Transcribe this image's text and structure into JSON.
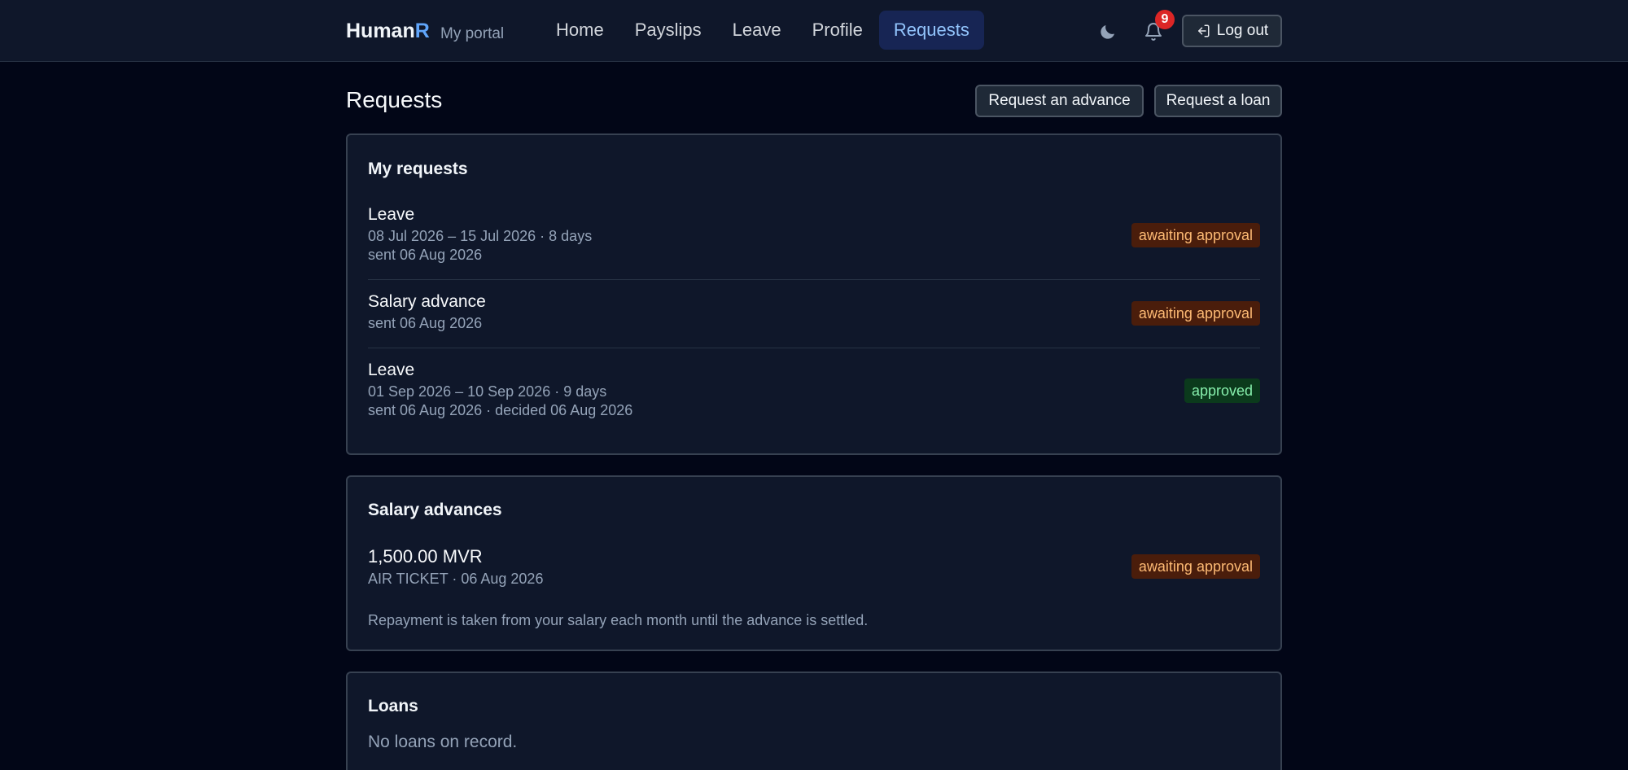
{
  "brand": {
    "name": "Human",
    "accent": "R",
    "subtitle": "My portal"
  },
  "nav": {
    "items": [
      {
        "label": "Home"
      },
      {
        "label": "Payslips"
      },
      {
        "label": "Leave"
      },
      {
        "label": "Profile"
      },
      {
        "label": "Requests",
        "active": true
      }
    ]
  },
  "header": {
    "notification_count": "9",
    "logout_label": "Log out",
    "theme_icon": "moon-icon",
    "bell_icon": "bell-icon",
    "logout_icon": "logout-icon"
  },
  "page": {
    "title": "Requests",
    "actions": {
      "advance_label": "Request an advance",
      "loan_label": "Request a loan"
    }
  },
  "my_requests": {
    "title": "My requests",
    "items": [
      {
        "type": "Leave",
        "line1": "08 Jul 2026 – 15 Jul 2026 · 8 days",
        "line2": "sent 06 Aug 2026",
        "status": "awaiting approval"
      },
      {
        "type": "Salary advance",
        "line1": "sent 06 Aug 2026",
        "status": "awaiting approval"
      },
      {
        "type": "Leave",
        "line1": "01 Sep 2026 – 10 Sep 2026 · 9 days",
        "line2": "sent 06 Aug 2026 · decided 06 Aug 2026",
        "status": "approved"
      }
    ]
  },
  "salary_advances": {
    "title": "Salary advances",
    "items": [
      {
        "amount": "1,500.00 MVR",
        "detail": "AIR TICKET · 06 Aug 2026",
        "status": "awaiting approval"
      }
    ],
    "note": "Repayment is taken from your salary each month until the advance is settled."
  },
  "loans": {
    "title": "Loans",
    "empty_text": "No loans on record."
  },
  "colors": {
    "background": "#020617",
    "surface": "#0f172a",
    "accent": "#60a5fa",
    "pending_bg": "#4a1d0b",
    "pending_text": "#fdba74",
    "approved_bg": "#0b3a1c",
    "approved_text": "#86efac",
    "badge": "#dc2626"
  }
}
